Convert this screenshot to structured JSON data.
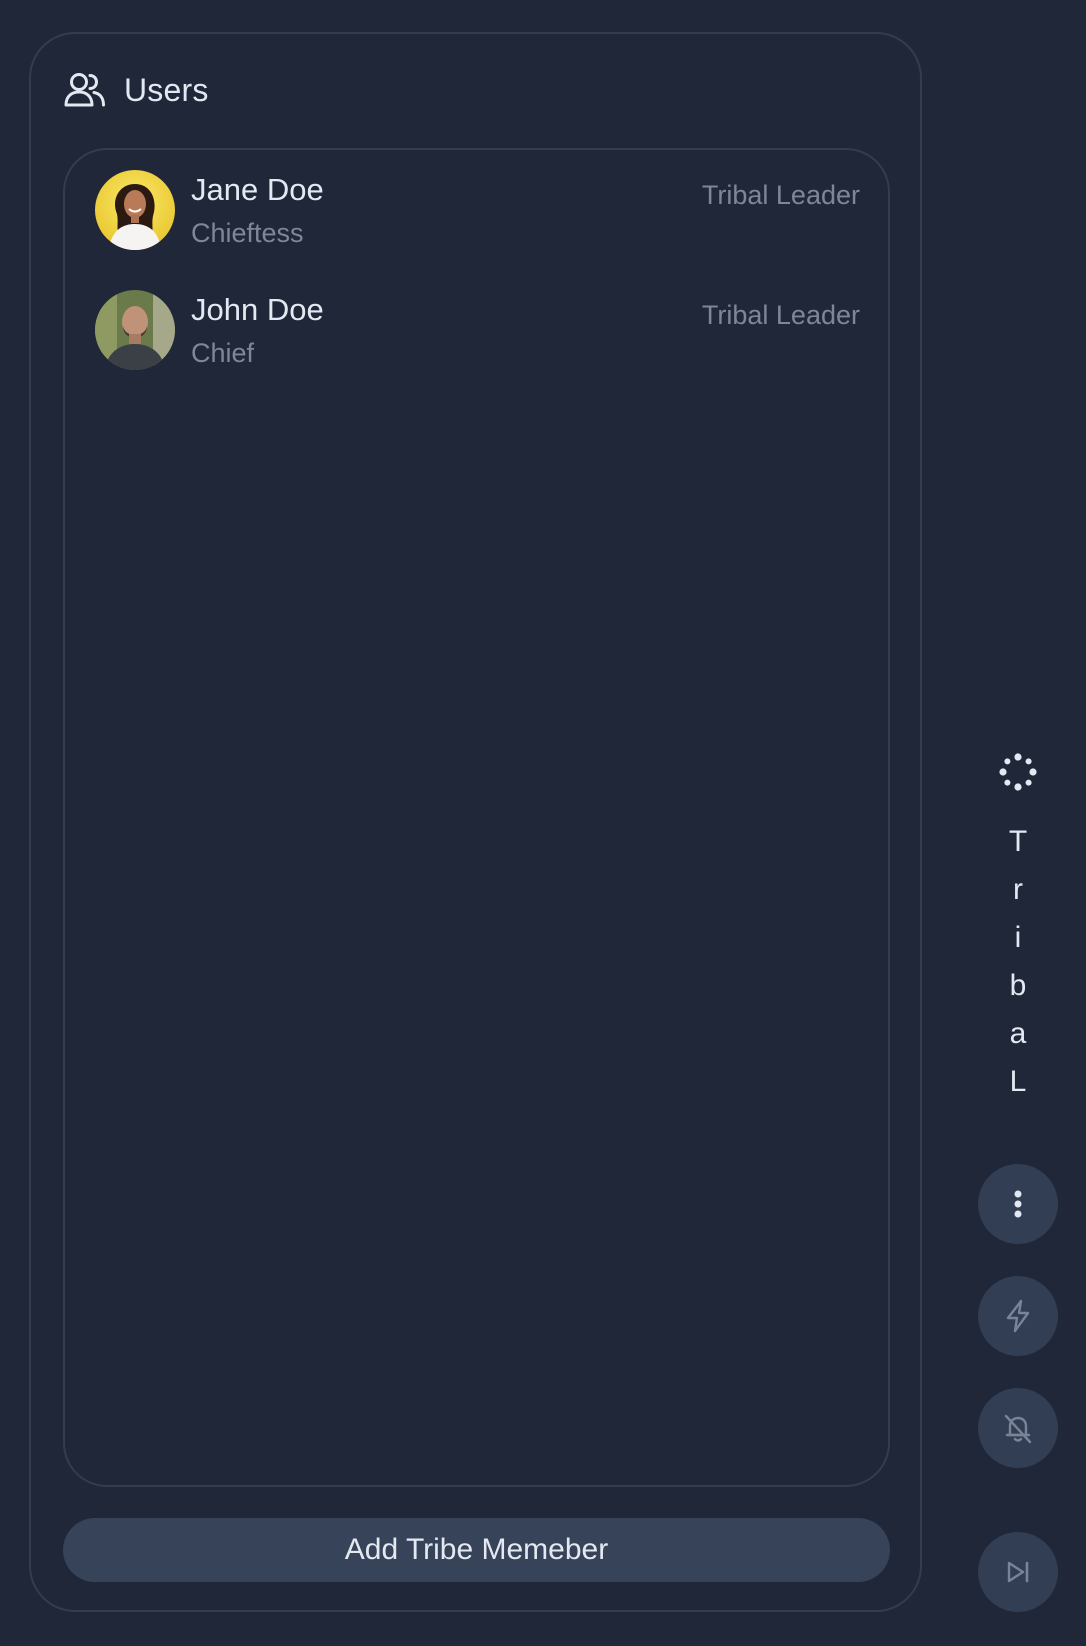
{
  "panel": {
    "title": "Users",
    "title_icon": "users-icon"
  },
  "users": [
    {
      "name": "Jane Doe",
      "title": "Chieftess",
      "role": "Tribal Leader",
      "avatar": "avatar-photo-woman"
    },
    {
      "name": "John Doe",
      "title": "Chief",
      "role": "Tribal Leader",
      "avatar": "avatar-photo-man"
    }
  ],
  "add_button": {
    "label": "Add Tribe Memeber"
  },
  "rail": {
    "vertical_letters": [
      "T",
      "r",
      "i",
      "b",
      "a",
      "L"
    ],
    "icons": [
      "spinner-icon",
      "more-vertical-icon",
      "lightning-icon",
      "bell-off-icon",
      "skip-forward-icon"
    ]
  },
  "colors": {
    "background": "#1f2739",
    "border": "#323d52",
    "button": "#374359",
    "rail_button": "#323e53",
    "text_primary": "#e3e8f1",
    "text_secondary": "#7e8799"
  }
}
